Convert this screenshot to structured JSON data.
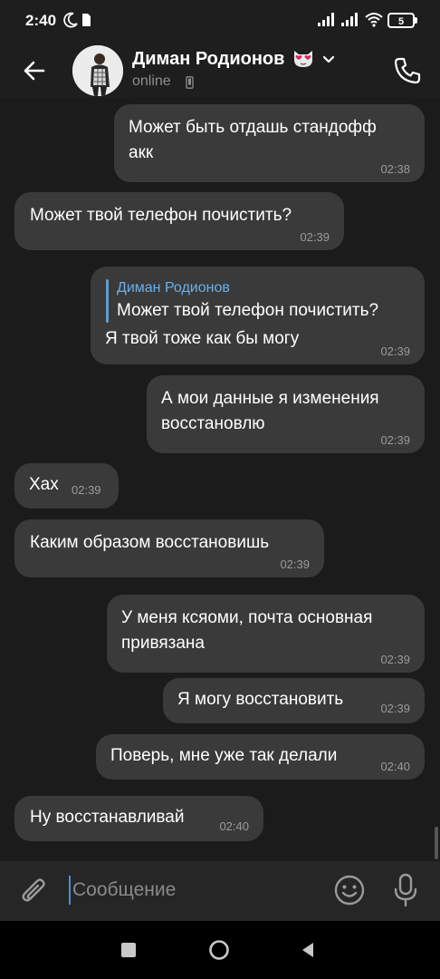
{
  "status_bar": {
    "time": "2:40",
    "battery_level": "5"
  },
  "header": {
    "contact_name": "Диман Родионов",
    "status": "online",
    "name_emoji": "cat-heart-eyes-emoji"
  },
  "messages": [
    {
      "direction": "out",
      "text_lines": [
        "Может быть отдашь стандофф",
        "акк"
      ],
      "time": "02:38"
    },
    {
      "direction": "in",
      "text_lines": [
        "Может твой телефон почистить?"
      ],
      "time": "02:39"
    },
    {
      "direction": "out",
      "reply_to": {
        "name": "Диман Родионов",
        "text": "Может твой телефон почистить?"
      },
      "text_lines": [
        "Я твой тоже как бы могу"
      ],
      "time": "02:39"
    },
    {
      "direction": "out",
      "text_lines": [
        "А мои данные я изменения",
        "восстановлю"
      ],
      "time": "02:39"
    },
    {
      "direction": "in",
      "text_lines": [
        "Хах"
      ],
      "time": "02:39"
    },
    {
      "direction": "in",
      "text_lines": [
        "Каким образом восстановишь"
      ],
      "time": "02:39"
    },
    {
      "direction": "out",
      "text_lines": [
        "У меня ксяоми, почта основная",
        "привязана"
      ],
      "time": "02:39"
    },
    {
      "direction": "out",
      "text_lines": [
        "Я могу восстановить"
      ],
      "time": "02:39"
    },
    {
      "direction": "out",
      "text_lines": [
        "Поверь, мне уже так делали"
      ],
      "time": "02:40"
    },
    {
      "direction": "in",
      "text_lines": [
        "Ну восстанавливай"
      ],
      "time": "02:40"
    }
  ],
  "input": {
    "placeholder": "Сообщение"
  },
  "icons": {
    "back": "arrow-left-icon",
    "call": "phone-icon",
    "attach": "paperclip-icon",
    "emoji": "smiley-icon",
    "mic": "microphone-icon"
  },
  "colors": {
    "background": "#1b1b1b",
    "bubble": "#3a3a3a",
    "reply_accent": "#6cb0ea",
    "input_cursor": "#4a8fd6"
  }
}
